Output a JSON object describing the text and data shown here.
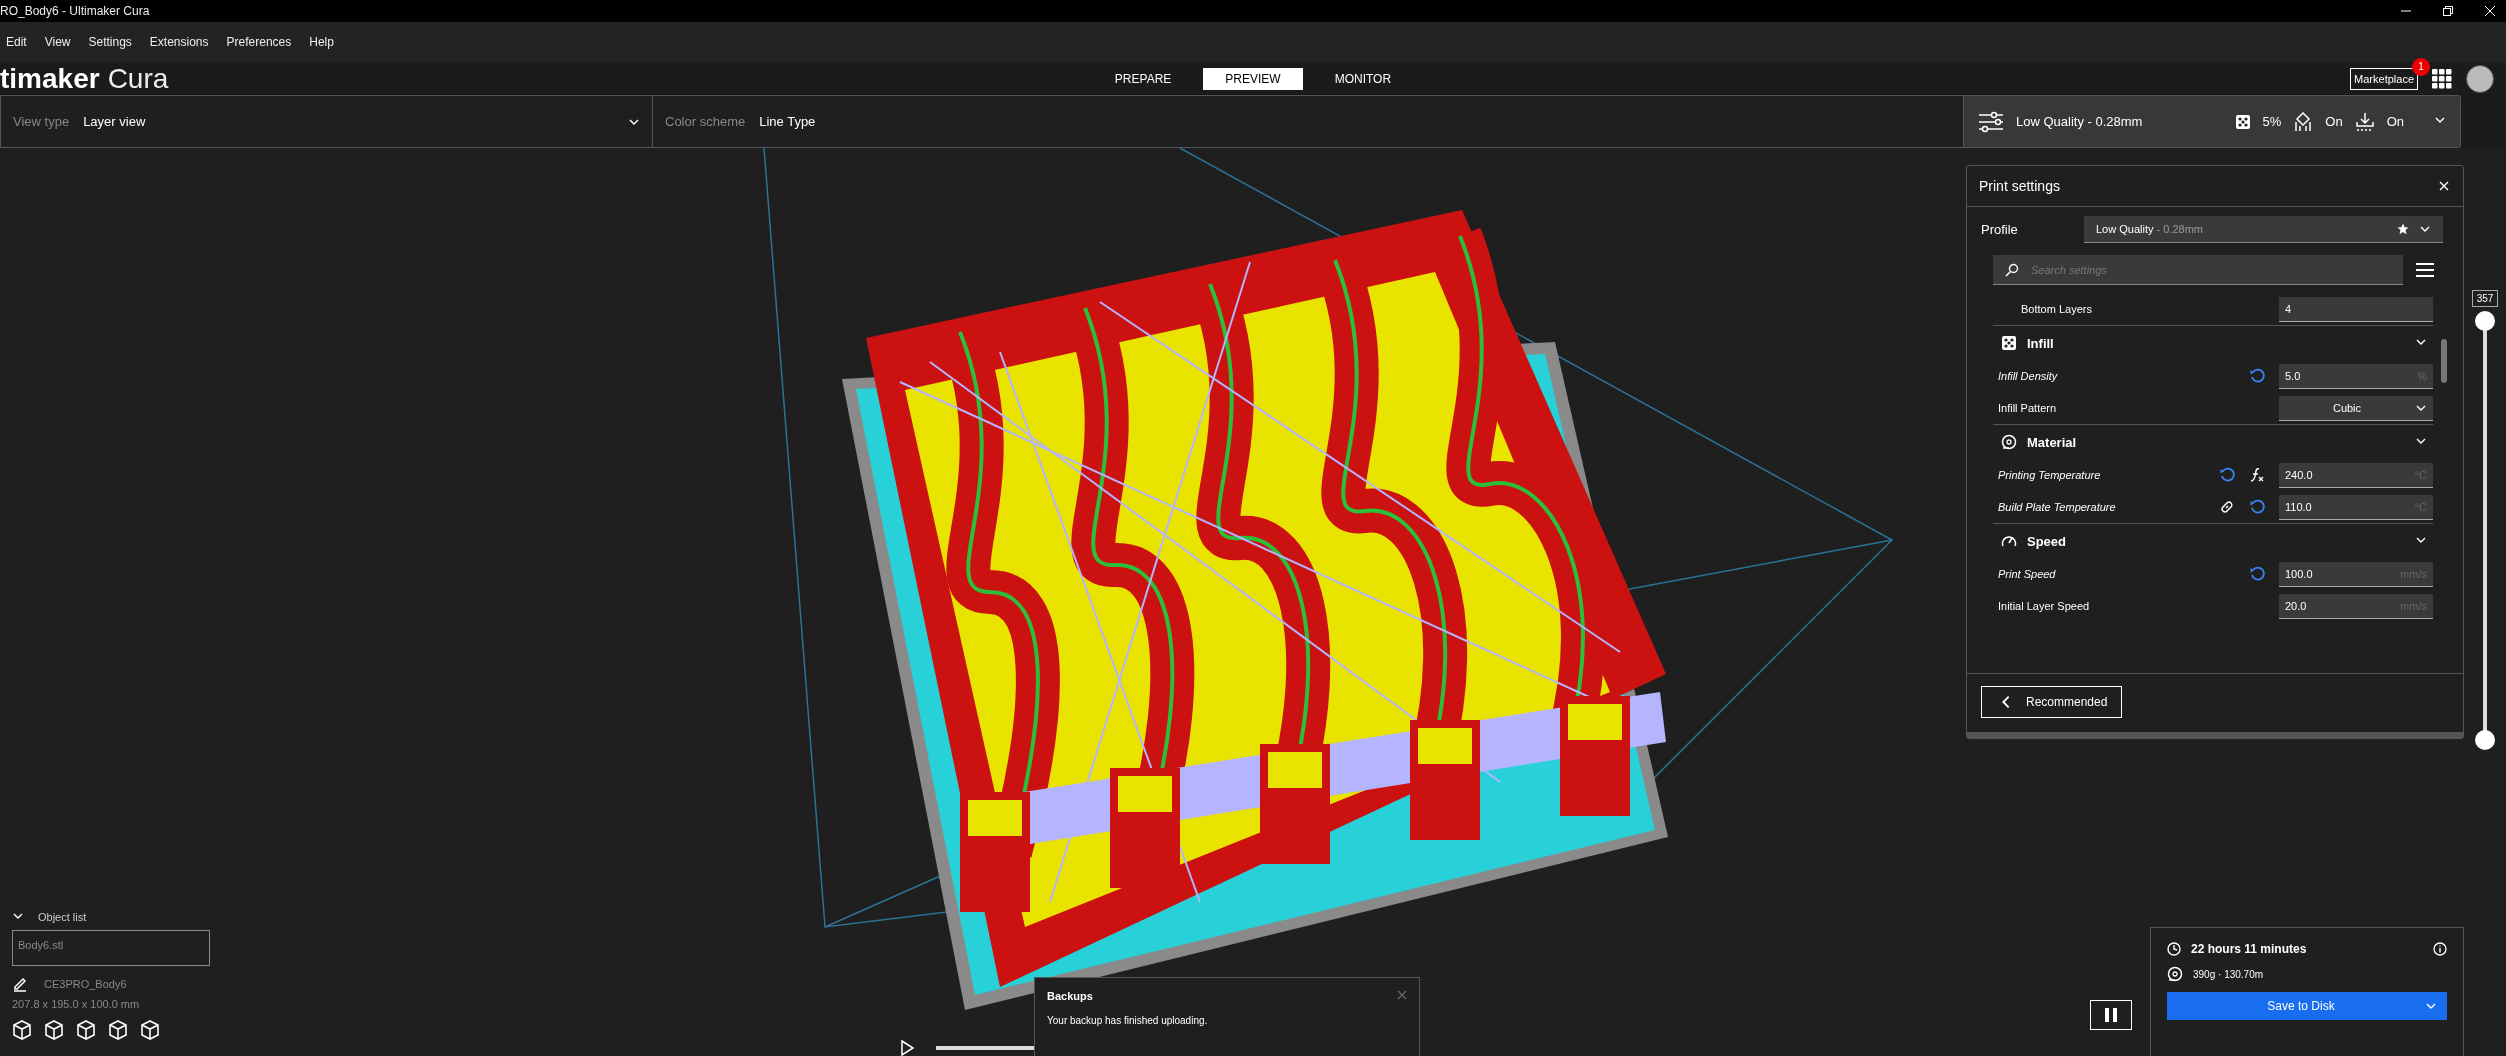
{
  "window": {
    "title": "RO_Body6 - Ultimaker Cura"
  },
  "menu": [
    "Edit",
    "View",
    "Settings",
    "Extensions",
    "Preferences",
    "Help"
  ],
  "header": {
    "logo_bold": "timaker",
    "logo_light": "Cura",
    "tabs": [
      {
        "label": "PREPARE",
        "selected": false
      },
      {
        "label": "PREVIEW",
        "selected": true
      },
      {
        "label": "MONITOR",
        "selected": false
      }
    ],
    "marketplace": "Marketplace",
    "marketplace_badge": "1"
  },
  "toolbar": {
    "view_type_label": "View type",
    "view_type": "Layer view",
    "color_scheme_label": "Color scheme",
    "color_scheme": "Line Type",
    "profile": "Low Quality - 0.28mm",
    "infill": "5%",
    "support": "On",
    "adhesion": "On"
  },
  "print_settings": {
    "title": "Print settings",
    "profile_label": "Profile",
    "profile_name": "Low Quality",
    "profile_layer": " - 0.28mm",
    "search_placeholder": "Search settings",
    "rows": [
      {
        "kind": "child-number",
        "label": "Bottom Layers",
        "value": "4",
        "modified": false,
        "reset": false,
        "formula": false,
        "linked": false
      },
      {
        "kind": "category",
        "label": "Infill",
        "expanded": true
      },
      {
        "kind": "number",
        "label": "Infill Density",
        "value": "5.0",
        "unit": "%",
        "modified": true,
        "reset": true,
        "formula": false,
        "linked": false
      },
      {
        "kind": "dropdown",
        "label": "Infill Pattern",
        "value": "Cubic",
        "modified": false,
        "reset": false,
        "formula": false,
        "linked": false
      },
      {
        "kind": "category",
        "label": "Material",
        "expanded": true
      },
      {
        "kind": "number",
        "label": "Printing Temperature",
        "value": "240.0",
        "unit": "°C",
        "modified": true,
        "reset": true,
        "formula": true,
        "linked": false
      },
      {
        "kind": "number",
        "label": "Build Plate Temperature",
        "value": "110.0",
        "unit": "°C",
        "modified": true,
        "reset": true,
        "formula": false,
        "linked": true
      },
      {
        "kind": "category",
        "label": "Speed",
        "expanded": true
      },
      {
        "kind": "number",
        "label": "Print Speed",
        "value": "100.0",
        "unit": "mm/s",
        "modified": true,
        "reset": true,
        "formula": false,
        "linked": false
      },
      {
        "kind": "number",
        "label": "Initial Layer Speed",
        "value": "20.0",
        "unit": "mm/s",
        "modified": false,
        "reset": false,
        "formula": false,
        "linked": false
      }
    ],
    "back_button": "Recommended"
  },
  "layer_slider": {
    "value": "357",
    "level": 1
  },
  "simulation_slider": {
    "level": 1
  },
  "object_list": {
    "title": "Object list",
    "expanded": true,
    "items": [
      {
        "name": "Body6.stl",
        "selected": false
      }
    ],
    "job_name": "CE3PRO_Body6",
    "dimensions": "207.8 x 195.0 x 100.0 mm"
  },
  "notification": {
    "title": "Backups",
    "message": "Your backup has finished uploading."
  },
  "print_summary": {
    "time": "22 hours 11 minutes",
    "material": "390g · 130.70m",
    "save_button": "Save to Disk"
  }
}
